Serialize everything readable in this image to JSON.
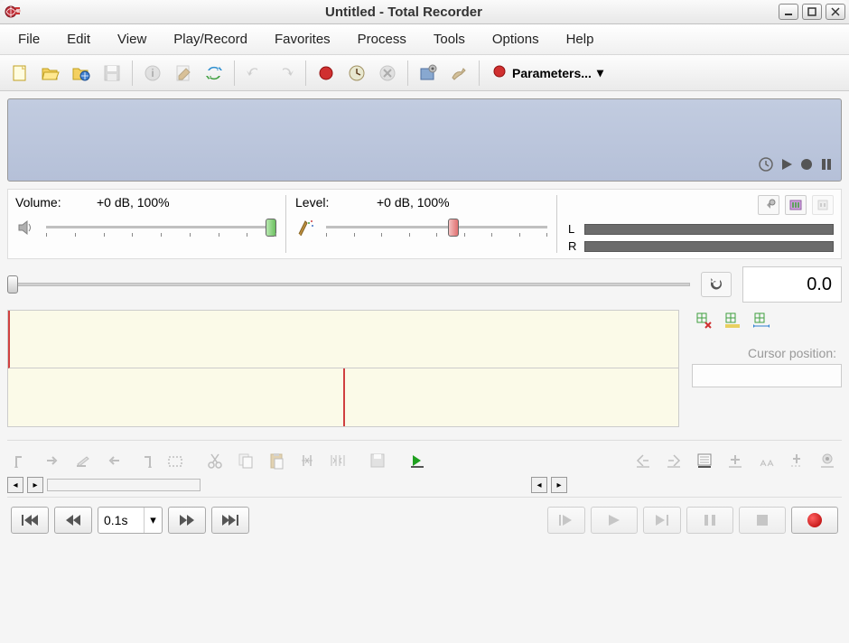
{
  "titlebar": {
    "title": "Untitled - Total Recorder"
  },
  "menu": {
    "items": [
      "File",
      "Edit",
      "View",
      "Play/Record",
      "Favorites",
      "Process",
      "Tools",
      "Options",
      "Help"
    ]
  },
  "toolbar": {
    "parameters_label": "Parameters..."
  },
  "volume": {
    "label": "Volume:",
    "value": "+0 dB, 100%"
  },
  "level": {
    "label": "Level:",
    "value": "+0 dB, 100%"
  },
  "meters": {
    "left": "L",
    "right": "R"
  },
  "seek": {
    "time": "0.0"
  },
  "cursor": {
    "label": "Cursor position:"
  },
  "transport": {
    "step": "0.1s"
  }
}
